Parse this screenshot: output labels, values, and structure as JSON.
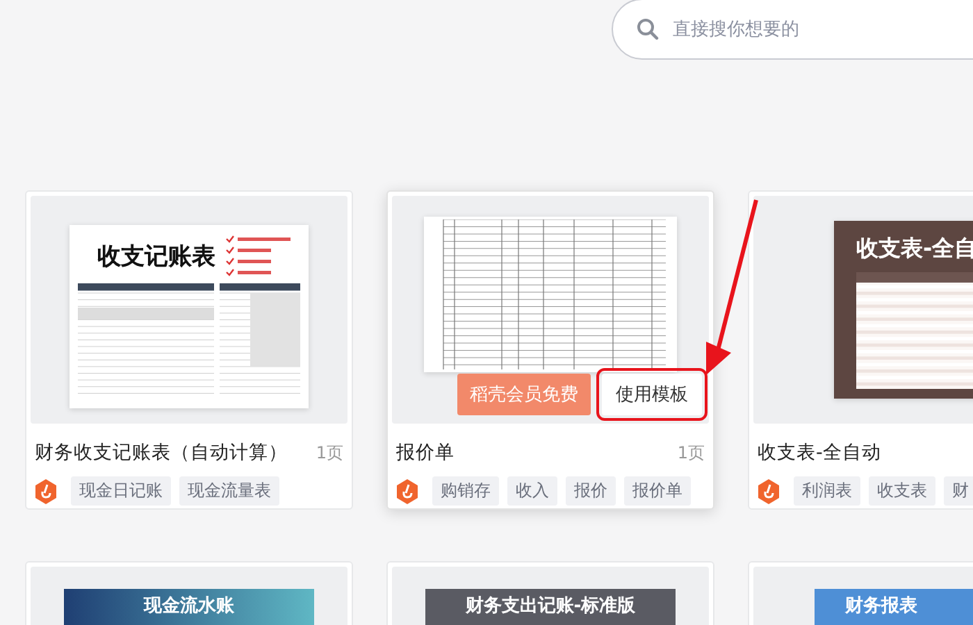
{
  "search": {
    "placeholder": "直接搜你想要的"
  },
  "templates": [
    {
      "kind": "ledger",
      "preview_title": "收支记账表",
      "title": "财务收支记账表（自动计算）",
      "pages": "1页",
      "tags": [
        "现金日记账",
        "现金流量表"
      ],
      "hovered": false
    },
    {
      "kind": "grid",
      "title": "报价单",
      "pages": "1页",
      "tags": [
        "购销存",
        "收入",
        "报价",
        "报价单"
      ],
      "hovered": true,
      "actions": [
        "稻壳会员免费",
        "使用模板"
      ]
    },
    {
      "kind": "brown",
      "preview_title": "收支表-全自",
      "title": "收支表-全自动",
      "tags": [
        "利润表",
        "收支表",
        "财"
      ],
      "hovered": false
    }
  ],
  "more_templates": [
    {
      "kind": "teal",
      "preview_title": "现金流水账"
    },
    {
      "kind": "slate",
      "preview_title": "财务支出记账-标准版"
    },
    {
      "kind": "blue",
      "preview_title": "财务报表"
    }
  ]
}
